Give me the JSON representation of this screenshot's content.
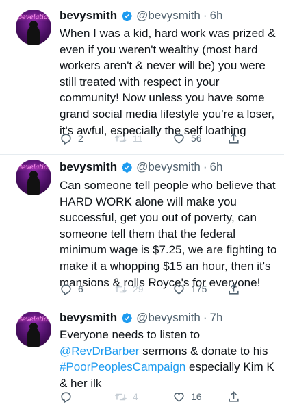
{
  "tweets": [
    {
      "name": "bevysmith",
      "handle": "@bevysmith",
      "separator": "·",
      "time": "6h",
      "avatar_text": "Bevelations",
      "text": "When I was a kid, hard work was prized & even if you weren't wealthy (most hard workers aren't & never will be) you were still treated with respect in your community! Now unless you have some grand social media lifestyle you're a loser, it's awful, especially the self loathing",
      "replies": "2",
      "retweets": "11",
      "likes": "56"
    },
    {
      "name": "bevysmith",
      "handle": "@bevysmith",
      "separator": "·",
      "time": "6h",
      "avatar_text": "Bevelations",
      "text": "Can someone tell people who believe that HARD WORK alone will make you successful, get you out of poverty, can someone tell them that the federal minimum wage is $7.25, we are fighting to make it a whopping $15 an hour, then it's mansions & rolls Royce's for everyone!",
      "replies": "6",
      "retweets": "29",
      "likes": "175"
    },
    {
      "name": "bevysmith",
      "handle": "@bevysmith",
      "separator": "·",
      "time": "7h",
      "avatar_text": "Bevelations",
      "text_before": "Everyone needs to listen to ",
      "mention": "@RevDrBarber",
      "text_middle": " sermons & donate to his ",
      "hashtag": "#PoorPeoplesCampaign",
      "text_after": " especially Kim K & her ilk",
      "replies": "",
      "retweets": "4",
      "likes": "16"
    }
  ],
  "colors": {
    "text": "#0f1419",
    "secondary": "#536471",
    "link": "#1d9bf0",
    "verified": "#1d9bf0",
    "divider": "#e6ecf0"
  },
  "icons": [
    "reply-icon",
    "retweet-icon",
    "like-icon",
    "share-icon",
    "verified-badge-icon"
  ]
}
